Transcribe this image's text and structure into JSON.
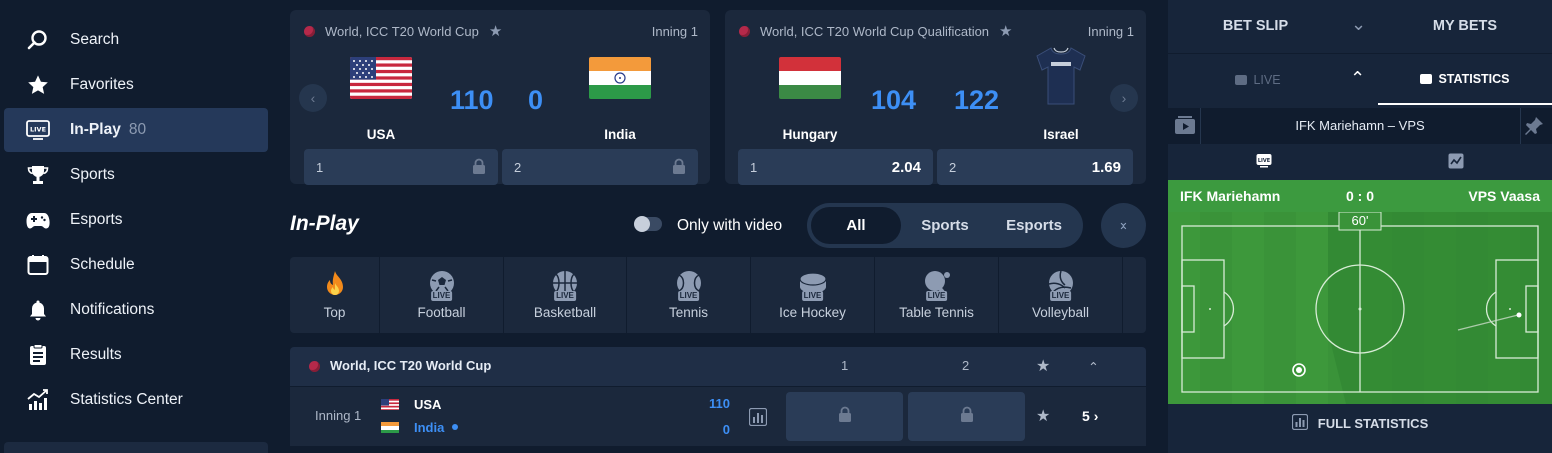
{
  "sidebar": {
    "items": [
      {
        "label": "Search",
        "icon": "search-icon"
      },
      {
        "label": "Favorites",
        "icon": "star-icon"
      },
      {
        "label": "In-Play",
        "icon": "live-icon",
        "count": "80",
        "active": true
      },
      {
        "label": "Sports",
        "icon": "trophy-icon"
      },
      {
        "label": "Esports",
        "icon": "gamepad-icon"
      },
      {
        "label": "Schedule",
        "icon": "calendar-icon"
      },
      {
        "label": "Notifications",
        "icon": "bell-icon"
      },
      {
        "label": "Results",
        "icon": "results-icon"
      },
      {
        "label": "Statistics Center",
        "icon": "stats-chart-icon"
      }
    ]
  },
  "cards": [
    {
      "competition": "World, ICC T20 World Cup",
      "inning": "Inning 1",
      "home": {
        "name": "USA",
        "score": "110",
        "flag": "us-flag-icon"
      },
      "away": {
        "name": "India",
        "score": "0",
        "flag": "india-flag-icon"
      },
      "odds": [
        {
          "label": "1",
          "locked": true
        },
        {
          "label": "2",
          "locked": true
        }
      ]
    },
    {
      "competition": "World, ICC T20 World Cup Qualification",
      "inning": "Inning 1",
      "home": {
        "name": "Hungary",
        "score": "104",
        "flag": "hungary-flag-icon"
      },
      "away": {
        "name": "Israel",
        "score": "122",
        "flag": "jersey-icon"
      },
      "odds": [
        {
          "label": "1",
          "value": "2.04"
        },
        {
          "label": "2",
          "value": "1.69"
        }
      ]
    }
  ],
  "inplay": {
    "title": "In-Play",
    "video_toggle_label": "Only with video",
    "filters": [
      "All",
      "Sports",
      "Esports"
    ],
    "active_filter": "All"
  },
  "sports": [
    {
      "label": "Top",
      "icon": "fire-icon"
    },
    {
      "label": "Football",
      "icon": "football-live-icon"
    },
    {
      "label": "Basketball",
      "icon": "basketball-live-icon"
    },
    {
      "label": "Tennis",
      "icon": "tennis-live-icon"
    },
    {
      "label": "Ice Hockey",
      "icon": "ice-hockey-live-icon"
    },
    {
      "label": "Table Tennis",
      "icon": "table-tennis-live-icon"
    },
    {
      "label": "Volleyball",
      "icon": "volleyball-live-icon"
    }
  ],
  "live_tag": "LIVE",
  "event_group": {
    "competition": "World, ICC T20 World Cup",
    "col1": "1",
    "col2": "2",
    "row": {
      "status": "Inning 1",
      "home": {
        "name": "USA",
        "score": "110"
      },
      "away": {
        "name": "India",
        "score": "0"
      },
      "more_markets": "5"
    }
  },
  "right_panel": {
    "tabs": [
      "BET SLIP",
      "MY BETS"
    ],
    "subtabs": {
      "live": "LIVE",
      "statistics": "STATISTICS"
    },
    "match_title": "IFK Mariehamn – VPS",
    "home_team": "IFK Mariehamn",
    "away_team": "VPS Vaasa",
    "score": "0 : 0",
    "minute": "60'",
    "full_stats_label": "FULL STATISTICS"
  },
  "colors": {
    "accent_blue": "#3d8ff5",
    "pitch_green": "#3a9339",
    "background": "#101c2e",
    "card": "#1b283c"
  }
}
